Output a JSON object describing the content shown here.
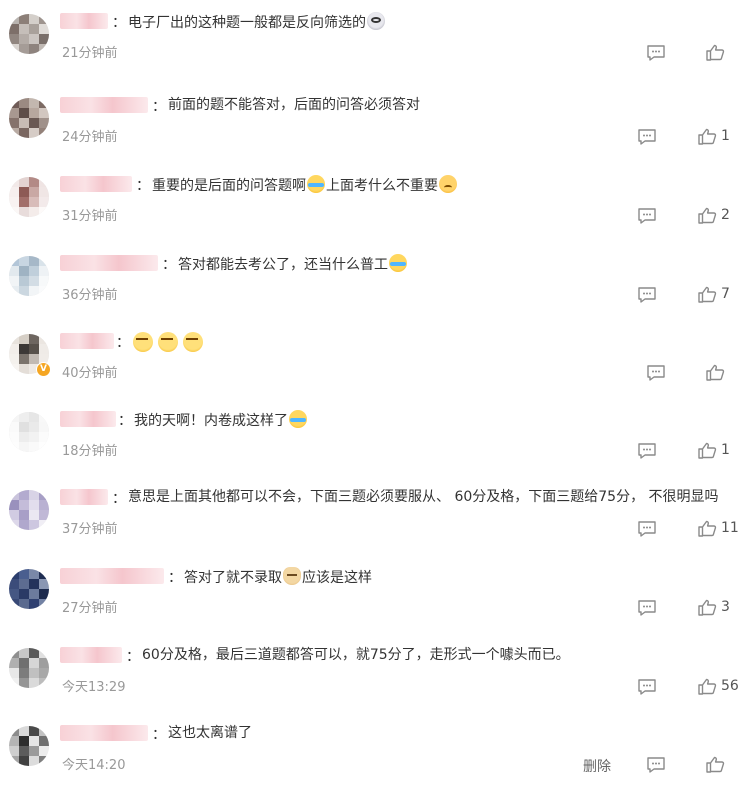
{
  "comments": [
    {
      "text_parts": [
        "电子厂出的这种题一般都是反向筛选的"
      ],
      "emojis": [
        "crazy-face"
      ],
      "time": "21分钟前",
      "likes": ""
    },
    {
      "text_parts": [
        "前面的题不能答对，后面的问答必须答对"
      ],
      "emojis": [],
      "time": "24分钟前",
      "likes": "1"
    },
    {
      "text_parts": [
        "重要的是后面的问答题啊",
        "上面考什么不重要"
      ],
      "emojis": [
        "laugh-cry",
        "upset-face"
      ],
      "time": "31分钟前",
      "likes": "2"
    },
    {
      "text_parts": [
        "答对都能去考公了，还当什么普工"
      ],
      "emojis": [
        "laugh-cry"
      ],
      "time": "36分钟前",
      "likes": "7"
    },
    {
      "text_parts": [],
      "emojis": [
        "sleepy-face",
        "sleepy-face",
        "sleepy-face"
      ],
      "time": "40分钟前",
      "likes": "",
      "verified_badge": "V"
    },
    {
      "text_parts": [
        "我的天啊！内卷成这样了"
      ],
      "emojis": [
        "laugh-cry"
      ],
      "time": "18分钟前",
      "likes": "1"
    },
    {
      "text_parts": [
        "意思是上面其他都可以不会，下面三题必须要服从、 60分及格，下面三题给75分， 不很明显吗"
      ],
      "emojis": [],
      "time": "37分钟前",
      "likes": "11"
    },
    {
      "text_parts": [
        "答对了就不录取",
        "应该是这样"
      ],
      "emojis": [
        "doge-face"
      ],
      "time": "27分钟前",
      "likes": "3"
    },
    {
      "text_parts": [
        "60分及格，最后三道题都答可以，就75分了，走形式一个噱头而已。"
      ],
      "emojis": [],
      "time": "今天13:29",
      "likes": "56"
    },
    {
      "text_parts": [
        "这也太离谱了"
      ],
      "emojis": [],
      "time": "今天14:20",
      "likes": "",
      "delete_label": "删除"
    }
  ],
  "colon": "：",
  "icons": {
    "reply": "reply-icon",
    "like": "thumbs-up-icon"
  }
}
